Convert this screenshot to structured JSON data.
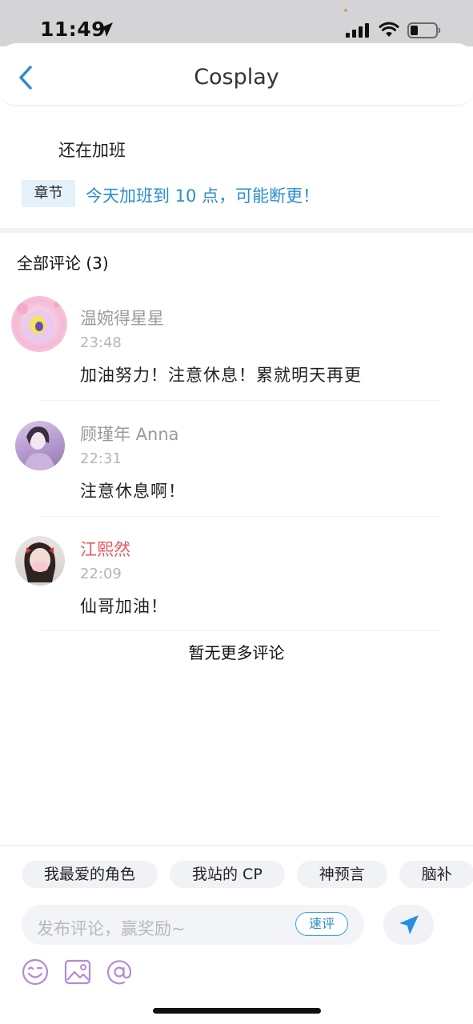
{
  "status_bar": {
    "time": "11:49"
  },
  "header": {
    "title": "Cosplay"
  },
  "post": {
    "text": "还在加班",
    "chapter_tag": "章节",
    "chapter_title": "今天加班到 10 点，可能断更！"
  },
  "comments_section": {
    "heading": "全部评论 (3)",
    "items": [
      {
        "name": "温婉得星星",
        "time": "23:48",
        "text": "加油努力！注意休息！累就明天再更"
      },
      {
        "name": "顾瑾年 Anna",
        "time": "22:31",
        "text": "注意休息啊！"
      },
      {
        "name": "江熙然",
        "time": "22:09",
        "text": "仙哥加油！"
      }
    ],
    "no_more": "暂无更多评论"
  },
  "composer": {
    "chips": [
      "我最爱的角色",
      "我站的 CP",
      "神预言",
      "脑补"
    ],
    "placeholder": "发布评论，赢奖励~",
    "quick_label": "速评"
  },
  "colors": {
    "accent": "#2a8ec8",
    "vip_name": "#e45a63",
    "icon_purple": "#b58ad6"
  },
  "icons": [
    "location-arrow-icon",
    "signal-icon",
    "wifi-icon",
    "battery-icon",
    "back-chevron-icon",
    "send-icon",
    "emoji-icon",
    "image-icon",
    "mention-icon"
  ]
}
